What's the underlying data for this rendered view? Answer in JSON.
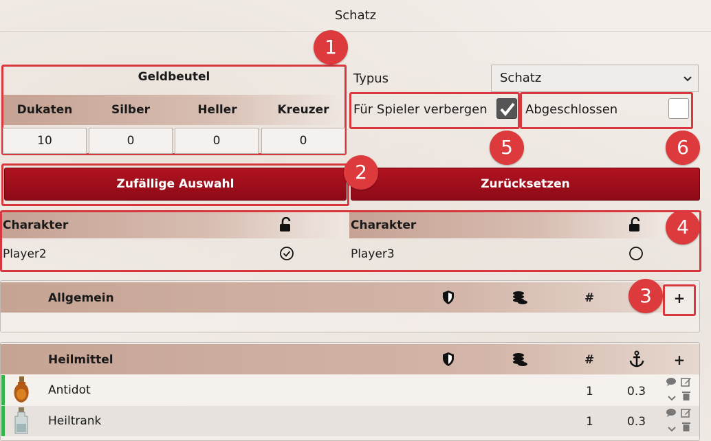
{
  "title": "Schatz",
  "badges": [
    "1",
    "2",
    "3",
    "4",
    "5",
    "6"
  ],
  "purse": {
    "title": "Geldbeutel",
    "headers": [
      "Dukaten",
      "Silber",
      "Heller",
      "Kreuzer"
    ],
    "values": [
      "10",
      "0",
      "0",
      "0"
    ]
  },
  "type": {
    "label": "Typus",
    "value": "Schatz"
  },
  "hide_for_players": {
    "label": "Für Spieler verbergen",
    "checked": true
  },
  "completed": {
    "label": "Abgeschlossen",
    "checked": false
  },
  "buttons": {
    "random": "Zufällige Auswahl",
    "reset": "Zurücksetzen"
  },
  "characters": {
    "header": "Charakter",
    "rows": [
      {
        "name": "Player2",
        "status": "checked"
      },
      {
        "name": "Player3",
        "status": "unchecked"
      }
    ]
  },
  "sections": [
    {
      "name": "Allgemein",
      "hash": "#",
      "plus": "+",
      "items": []
    },
    {
      "name": "Heilmittel",
      "hash": "#",
      "plus": "+",
      "items": [
        {
          "name": "Antidot",
          "qty": "1",
          "weight": "0.3"
        },
        {
          "name": "Heiltrank",
          "qty": "1",
          "weight": "0.3"
        }
      ]
    }
  ],
  "colors": {
    "accent_red": "#a0101c",
    "highlight": "#d8373d",
    "badge": "#dc3a3c",
    "equip_bar": "#36b34a"
  },
  "icons": [
    "lock-open-icon",
    "check-circle-icon",
    "circle-icon",
    "shield-icon",
    "coins-icon",
    "anchor-icon",
    "plus-icon",
    "comment-icon",
    "edit-icon",
    "chevron-down-icon",
    "trash-icon",
    "potion-icon"
  ]
}
